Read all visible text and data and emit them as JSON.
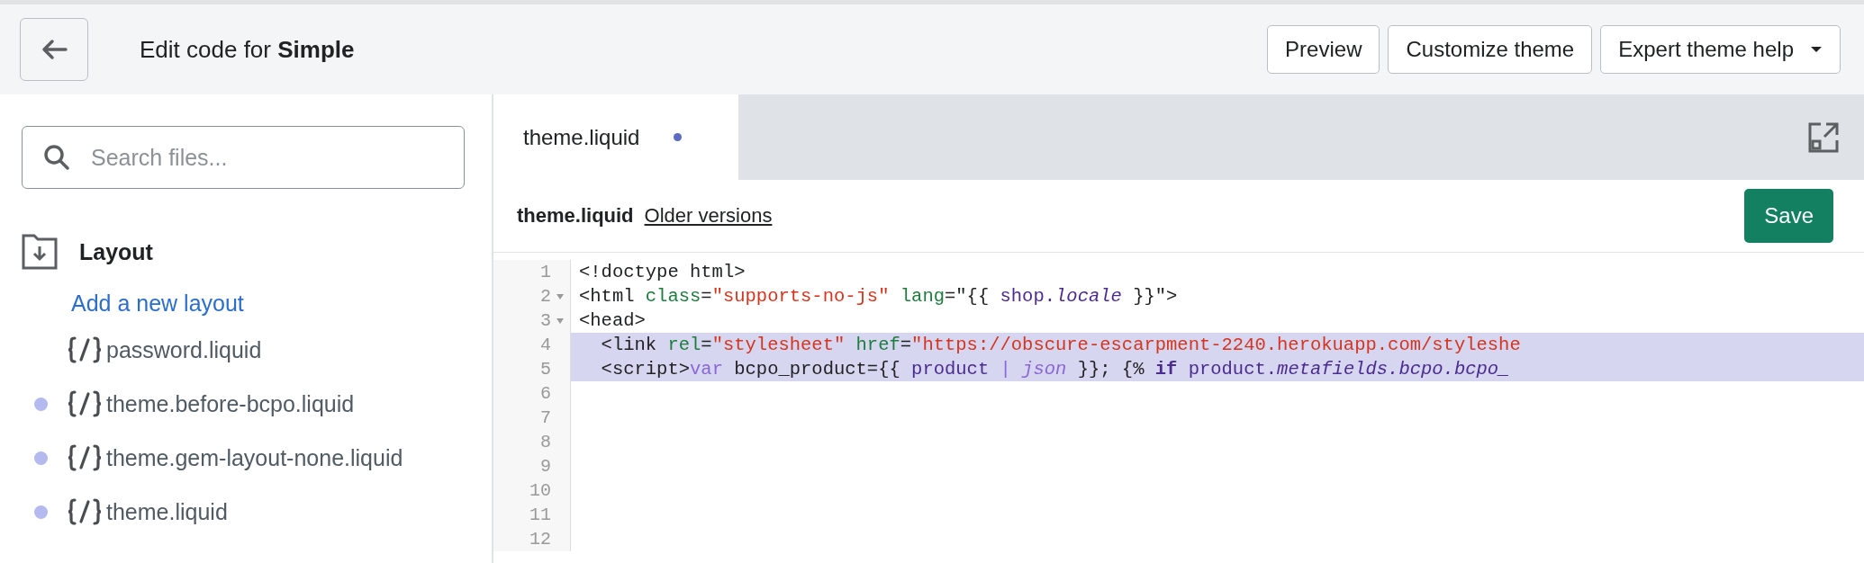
{
  "header": {
    "title": "Edit code for **Simple**",
    "buttons": [
      {
        "label": "Preview",
        "dropdown": false
      },
      {
        "label": "Customize theme",
        "dropdown": false
      },
      {
        "label": "Expert theme help",
        "dropdown": true
      }
    ]
  },
  "sidebar": {
    "search": {
      "placeholder": "Search files..."
    },
    "folder": {
      "name": "Layout",
      "add_link": "Add a new layout",
      "files": [
        {
          "name": "password.liquid",
          "modified": false
        },
        {
          "name": "theme.before-bcpo.liquid",
          "modified": true
        },
        {
          "name": "theme.gem-layout-none.liquid",
          "modified": true
        },
        {
          "name": "theme.liquid",
          "modified": true
        }
      ]
    }
  },
  "editor": {
    "tabs": [
      {
        "label": "theme.liquid",
        "selected": true,
        "unsaved": true
      }
    ],
    "file_name": "theme.liquid",
    "versions_link": "Older versions",
    "save_button": "Save",
    "lines": [
      {
        "number": "1",
        "fold": false,
        "selected": false,
        "tokens": [
          {
            "kind": "plain",
            "text": "<!doctype html>"
          }
        ]
      },
      {
        "number": "2",
        "fold": true,
        "selected": false,
        "tokens": [
          {
            "kind": "plain",
            "text": "<html "
          },
          {
            "kind": "attr",
            "text": "class"
          },
          {
            "kind": "plain",
            "text": "="
          },
          {
            "kind": "string",
            "text": "\"supports-no-js\""
          },
          {
            "kind": "attr",
            "text": " lang"
          },
          {
            "kind": "plain",
            "text": "=\"{{ "
          },
          {
            "kind": "variable",
            "text": "shop."
          },
          {
            "kind": "property",
            "text": "locale"
          },
          {
            "kind": "plain",
            "text": " }}\">"
          }
        ]
      },
      {
        "number": "3",
        "fold": true,
        "selected": false,
        "tokens": [
          {
            "kind": "plain",
            "text": "<head>"
          }
        ]
      },
      {
        "number": "4",
        "fold": false,
        "selected": true,
        "tokens": [
          {
            "kind": "plain",
            "text": "  <link "
          },
          {
            "kind": "attr",
            "text": "rel"
          },
          {
            "kind": "plain",
            "text": "="
          },
          {
            "kind": "string",
            "text": "\"stylesheet\""
          },
          {
            "kind": "attr",
            "text": " href"
          },
          {
            "kind": "plain",
            "text": "="
          },
          {
            "kind": "string",
            "text": "\"https://obscure-escarpment-2240.herokuapp.com/styleshe"
          }
        ]
      },
      {
        "number": "5",
        "fold": false,
        "selected": true,
        "tokens": [
          {
            "kind": "plain",
            "text": "  <script>"
          },
          {
            "kind": "keyword",
            "text": "var"
          },
          {
            "kind": "plain",
            "text": " bcpo_product={{ "
          },
          {
            "kind": "variable",
            "text": "product"
          },
          {
            "kind": "filter",
            "text": " | "
          },
          {
            "kind": "filter",
            "text": "json"
          },
          {
            "kind": "plain",
            "text": " }}; {% "
          },
          {
            "kind": "control",
            "text": "if"
          },
          {
            "kind": "variable",
            "text": " product."
          },
          {
            "kind": "property",
            "text": "metafields.bcpo.bcpo_"
          }
        ]
      },
      {
        "number": "6",
        "fold": false,
        "selected": false
      },
      {
        "number": "7",
        "fold": false,
        "selected": false
      },
      {
        "number": "8",
        "fold": false,
        "selected": false
      },
      {
        "number": "9",
        "fold": false,
        "selected": false
      },
      {
        "number": "10",
        "fold": false,
        "selected": false
      },
      {
        "number": "11",
        "fold": false,
        "selected": false
      },
      {
        "number": "12",
        "fold": false,
        "selected": false
      }
    ]
  }
}
